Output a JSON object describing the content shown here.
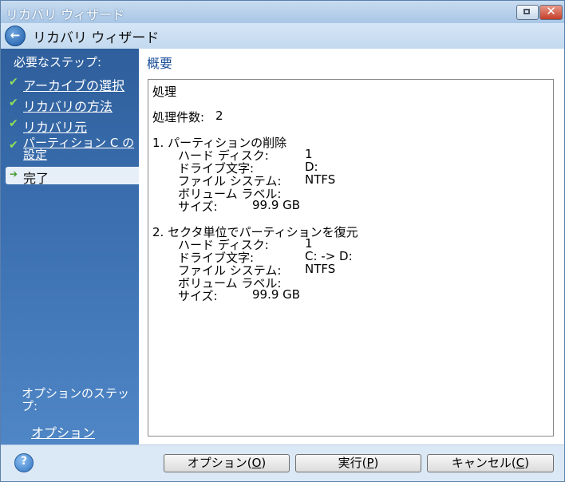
{
  "window": {
    "title": "リカバリ ウィザード"
  },
  "header": {
    "title": "リカバリ ウィザード"
  },
  "sidebar": {
    "heading": "必要なステップ:",
    "steps": [
      {
        "label": "アーカイブの選択"
      },
      {
        "label": "リカバリの方法"
      },
      {
        "label": "リカバリ元"
      },
      {
        "label": "パーティション C の設定"
      }
    ],
    "current_step": "完了",
    "options_heading": "オプションのステップ:",
    "options_link": "オプション"
  },
  "content": {
    "title": "概要",
    "summary": {
      "heading": "処理",
      "count_label": "処理件数:",
      "count_value": "2",
      "operations": [
        {
          "title": "1. パーティションの削除",
          "disk_label": "ハード ディスク:",
          "disk_value": "1",
          "drive_label": "ドライブ文字:",
          "drive_value": "D:",
          "fs_label": "ファイル システム:",
          "fs_value": "NTFS",
          "volume_label": "ボリューム ラベル:",
          "size_label": "サイズ:",
          "size_value": "99.9 GB"
        },
        {
          "title": "2. セクタ単位でパーティションを復元",
          "disk_label": "ハード ディスク:",
          "disk_value": "1",
          "drive_label": "ドライブ文字:",
          "drive_value": "C: -> D:",
          "fs_label": "ファイル システム:",
          "fs_value": "NTFS",
          "volume_label": "ボリューム ラベル:",
          "size_label": "サイズ:",
          "size_value": "99.9 GB"
        }
      ]
    }
  },
  "footer": {
    "options_button": {
      "label": "オプション",
      "key": "O"
    },
    "run_button": {
      "label": "実行",
      "key": "P"
    },
    "cancel_button": {
      "label": "キャンセル",
      "key": "C"
    }
  }
}
